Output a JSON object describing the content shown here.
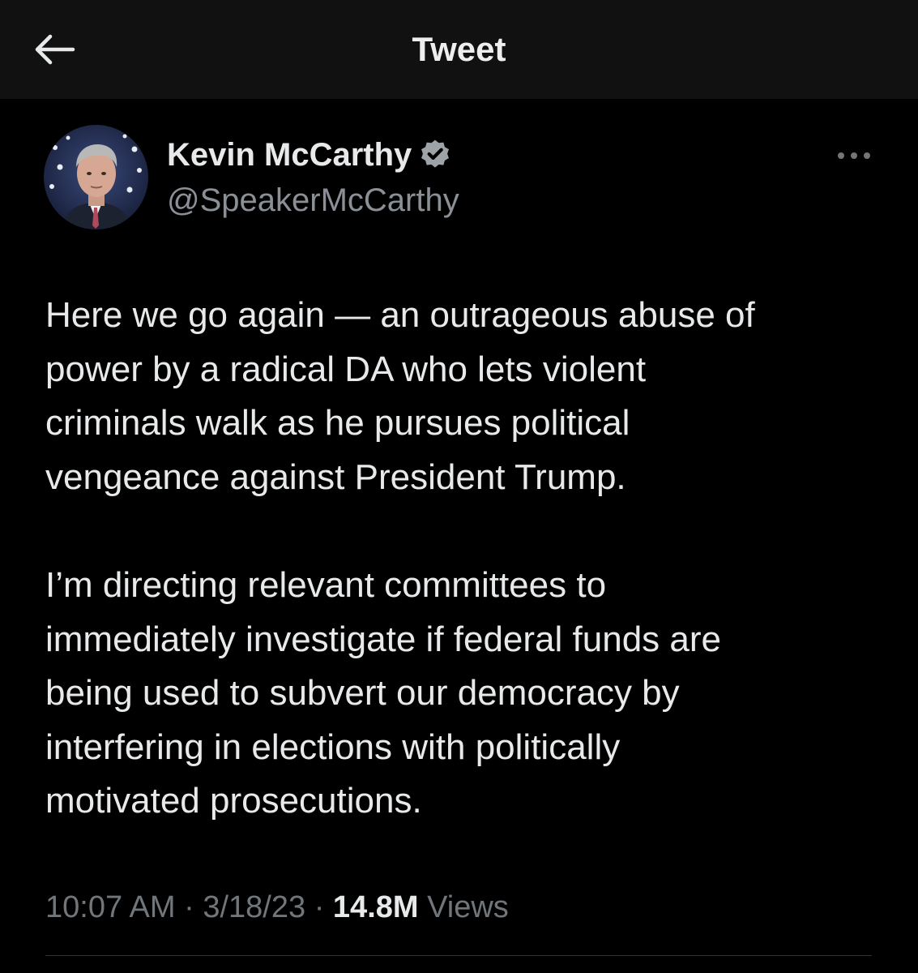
{
  "header": {
    "title": "Tweet",
    "back_icon": "arrow-left-icon"
  },
  "author": {
    "name": "Kevin McCarthy",
    "handle": "@SpeakerMcCarthy",
    "verified_icon": "verified-badge-icon",
    "verified_color": "#9ea3a8"
  },
  "more_icon": "more-horizontal-icon",
  "tweet": {
    "lines": [
      "Here we go again — an outrageous abuse of",
      "power by a radical DA who lets violent",
      "criminals walk as he pursues political",
      "vengeance against President Trump.",
      "",
      "I’m directing relevant committees to",
      "immediately investigate if federal funds are",
      "being used to subvert our democracy by",
      "interfering in elections with politically",
      "motivated prosecutions."
    ]
  },
  "meta": {
    "time": "10:07 AM",
    "sep1": " · ",
    "date": "3/18/23",
    "sep2": " · ",
    "views_count": "14.8M",
    "views_label": " Views"
  },
  "colors": {
    "background": "#000000",
    "header_background": "#111111",
    "text": "#e7e9ea",
    "muted": "#71767b",
    "handle": "#8b9096"
  }
}
